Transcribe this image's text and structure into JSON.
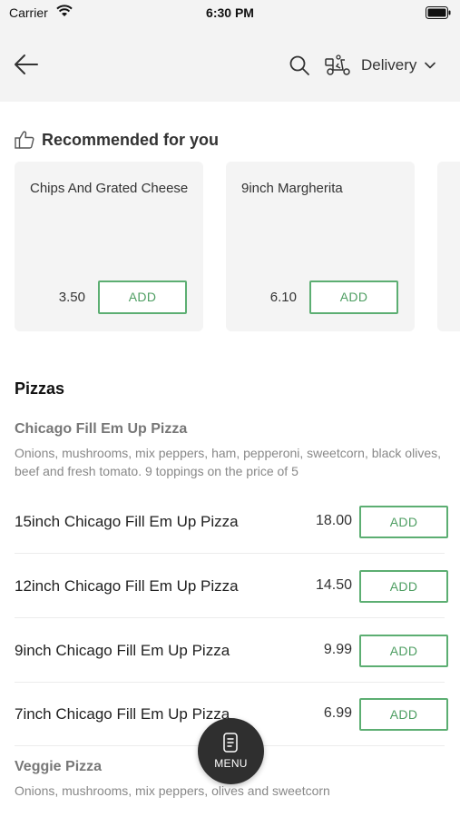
{
  "status_bar": {
    "carrier": "Carrier",
    "time": "6:30 PM"
  },
  "nav": {
    "delivery_label": "Delivery"
  },
  "recommended": {
    "heading": "Recommended for you",
    "items": [
      {
        "name": "Chips And Grated Cheese",
        "price": "3.50",
        "add_label": "ADD"
      },
      {
        "name": "9inch Margherita",
        "price": "6.10",
        "add_label": "ADD"
      }
    ]
  },
  "category": {
    "title": "Pizzas",
    "groups": [
      {
        "title": "Chicago Fill Em Up Pizza",
        "description": "Onions, mushrooms, mix peppers, ham, pepperoni, sweetcorn, black olives, beef and fresh tomato. 9 toppings on the price of 5",
        "items": [
          {
            "name": "15inch Chicago Fill Em Up Pizza",
            "price": "18.00",
            "add_label": "ADD"
          },
          {
            "name": "12inch Chicago Fill Em Up Pizza",
            "price": "14.50",
            "add_label": "ADD"
          },
          {
            "name": "9inch Chicago Fill Em Up Pizza",
            "price": "9.99",
            "add_label": "ADD"
          },
          {
            "name": "7inch Chicago Fill Em Up Pizza",
            "price": "6.99",
            "add_label": "ADD"
          }
        ]
      },
      {
        "title": "Veggie Pizza",
        "description": "Onions, mushrooms, mix peppers, olives and sweetcorn"
      }
    ]
  },
  "fab": {
    "label": "MENU"
  },
  "colors": {
    "accent_green": "#5cae72",
    "header_bg": "#f3f3f3",
    "card_bg": "#f4f4f4",
    "fab_bg": "#2f2f2f"
  }
}
